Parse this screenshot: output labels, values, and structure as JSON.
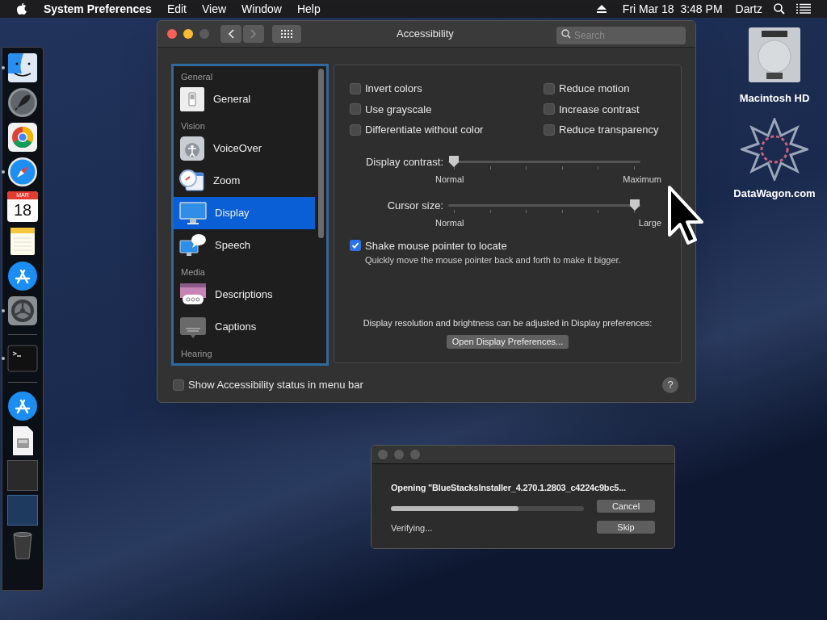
{
  "menubar": {
    "app_name": "System Preferences",
    "menus": [
      "Edit",
      "View",
      "Window",
      "Help"
    ],
    "clock": "Fri Mar 18  3:48 PM",
    "user": "Dartz"
  },
  "dock": [
    {
      "kind": "finder",
      "running": true
    },
    {
      "kind": "launchpad",
      "running": false
    },
    {
      "kind": "chrome",
      "running": false
    },
    {
      "kind": "safari",
      "running": true
    },
    {
      "kind": "calendar",
      "running": false,
      "month": "MAR",
      "day": "18"
    },
    {
      "kind": "notes",
      "running": false
    },
    {
      "kind": "appstore",
      "running": false
    },
    {
      "kind": "settings",
      "running": true
    },
    {
      "kind": "divider"
    },
    {
      "kind": "terminal",
      "running": true
    },
    {
      "kind": "divider"
    },
    {
      "kind": "downloads",
      "running": false
    },
    {
      "kind": "document",
      "running": false
    },
    {
      "kind": "thumbnail",
      "running": false
    },
    {
      "kind": "thumbnail",
      "running": false
    },
    {
      "kind": "trash",
      "running": false
    }
  ],
  "desktop_icons": [
    {
      "kind": "drive",
      "label": "Macintosh HD"
    },
    {
      "kind": "emblem",
      "label": "DataWagon.com"
    }
  ],
  "window": {
    "title": "Accessibility",
    "search": {
      "placeholder": "Search"
    },
    "back": {
      "disabled": false
    },
    "forward": {
      "disabled": true
    },
    "sidebar": [
      {
        "kind": "header",
        "label": "General"
      },
      {
        "kind": "general",
        "label": "General",
        "selected": false
      },
      {
        "kind": "header",
        "label": "Vision"
      },
      {
        "kind": "voiceover",
        "label": "VoiceOver",
        "selected": false
      },
      {
        "kind": "zoom",
        "label": "Zoom",
        "selected": false
      },
      {
        "kind": "display",
        "label": "Display",
        "selected": true
      },
      {
        "kind": "speech",
        "label": "Speech",
        "selected": false
      },
      {
        "kind": "header",
        "label": "Media"
      },
      {
        "kind": "descriptions",
        "label": "Descriptions",
        "selected": false
      },
      {
        "kind": "captions",
        "label": "Captions",
        "selected": false
      },
      {
        "kind": "header",
        "label": "Hearing"
      }
    ],
    "options": [
      {
        "label": "Invert colors",
        "checked": false
      },
      {
        "label": "Reduce motion",
        "checked": false
      },
      {
        "label": "Use grayscale",
        "checked": false
      },
      {
        "label": "Increase contrast",
        "checked": false
      },
      {
        "label": "Differentiate without color",
        "checked": false
      },
      {
        "label": "Reduce transparency",
        "checked": false
      }
    ],
    "sliders": [
      {
        "label": "Display contrast:",
        "level": 0,
        "min_label": "Normal",
        "max_label": "Maximum"
      },
      {
        "label": "Cursor size:",
        "level": 1,
        "min_label": "Normal",
        "max_label": "Large"
      }
    ],
    "shake": {
      "label": "Shake mouse pointer to locate",
      "checked": true,
      "description": "Quickly move the mouse pointer back and forth to make it bigger."
    },
    "display_note": "Display resolution and brightness can be adjusted in Display preferences:",
    "display_button": "Open Display Preferences...",
    "footer": {
      "label": "Show Accessibility status in menu bar",
      "checked": false
    },
    "help": "?"
  },
  "dialog": {
    "message": "Opening \"BlueStacksInstaller_4.270.1.2803_c4224c9bc5...",
    "progress": {
      "level": 0.66
    },
    "status": "Verifying...",
    "buttons": [
      "Cancel",
      "Skip"
    ]
  }
}
